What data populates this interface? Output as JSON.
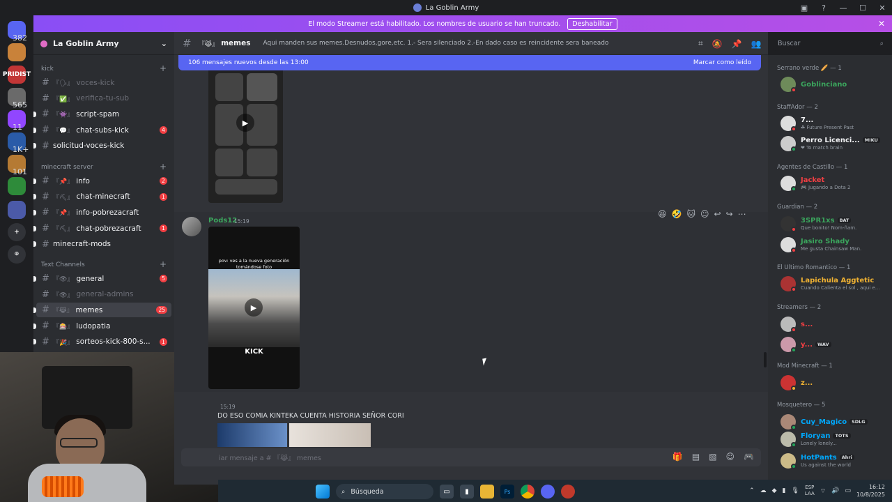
{
  "window": {
    "title": "La Goblin Army"
  },
  "banner": {
    "text": "El modo Streamer está habilitado. Los nombres de usuario se han truncado.",
    "button": "Deshabilitar"
  },
  "servers": [
    {
      "label": "",
      "count": "382",
      "color": "#5865f2"
    },
    {
      "label": "",
      "count": "",
      "color": "#c9823a"
    },
    {
      "label": "PRIDIST",
      "count": "",
      "color": "#c23636"
    },
    {
      "label": "",
      "count": "565",
      "color": "#6a6a6a"
    },
    {
      "label": "",
      "count": "11",
      "color": "#9146ff"
    },
    {
      "label": "",
      "count": "1K+",
      "color": "#2a5ba8"
    },
    {
      "label": "",
      "count": "101",
      "color": "#b57a33"
    },
    {
      "label": "",
      "count": "",
      "color": "#2e8b3a"
    },
    {
      "label": "",
      "count": "",
      "color": "#4b5aa8"
    }
  ],
  "guild": {
    "name": "La Goblin Army"
  },
  "categories": {
    "kick": "kick",
    "minecraft": "minecraft server",
    "text": "Text Channels"
  },
  "channels": {
    "kick": [
      {
        "emoji": "『🗣』",
        "name": "voces-kick",
        "badge": "",
        "state": "muted"
      },
      {
        "emoji": "『✅』",
        "name": "verifica-tu-sub",
        "badge": "",
        "state": "muted"
      },
      {
        "emoji": "『👾』",
        "name": "script-spam",
        "badge": "",
        "state": "unread"
      },
      {
        "emoji": "『💬』",
        "name": "chat-subs-kick",
        "badge": "4",
        "state": "unread"
      },
      {
        "emoji": "",
        "name": "solicitud-voces-kick",
        "badge": "",
        "state": "unread"
      }
    ],
    "minecraft": [
      {
        "emoji": "『📌』",
        "name": "info",
        "badge": "2",
        "state": "unread"
      },
      {
        "emoji": "『⛏』",
        "name": "chat-minecraft",
        "badge": "1",
        "state": "unread"
      },
      {
        "emoji": "『📌』",
        "name": "info-pobrezacraft",
        "badge": "",
        "state": "unread"
      },
      {
        "emoji": "『⛏』",
        "name": "chat-pobrezacraft",
        "badge": "1",
        "state": "unread"
      },
      {
        "emoji": "",
        "name": "minecraft-mods",
        "badge": "",
        "state": "unread"
      }
    ],
    "text": [
      {
        "emoji": "『👁』",
        "name": "general",
        "badge": "5",
        "state": "unread"
      },
      {
        "emoji": "『👁』",
        "name": "general-admins",
        "badge": "",
        "state": "muted"
      },
      {
        "emoji": "『😹』",
        "name": "memes",
        "badge": "25",
        "state": "active"
      },
      {
        "emoji": "『🎰』",
        "name": "ludopatia",
        "badge": "",
        "state": "unread"
      },
      {
        "emoji": "『🎉』",
        "name": "sorteos-kick-800-s...",
        "badge": "1",
        "state": "unread"
      }
    ]
  },
  "header": {
    "channel_emoji": "『😹』",
    "channel": "memes",
    "topic": "Aqui manden sus memes.Desnudos,gore,etc. 1.- Sera silenciado 2.-En dado caso es reincidente sera baneado"
  },
  "search": {
    "placeholder": "Buscar"
  },
  "newbar": {
    "text": "106 mensajes nuevos desde las 13:00",
    "action": "Marcar como leído"
  },
  "messages": [
    {
      "author": "Pods12",
      "time": "15:19",
      "video_caption": "pov: ves a la nueva generación tomándose foto",
      "video_brand": "KICK"
    },
    {
      "time": "15:19",
      "text": "DO ESO COMIA KINTEKA CUENTA HISTORIA SEÑOR CORI"
    }
  ],
  "composer": {
    "placeholder": "iar mensaje a # 『😹』 memes"
  },
  "members": {
    "groups": [
      {
        "title": "Serrano verde 🥖 — 1"
      },
      {
        "title": "StaffAdor — 2"
      },
      {
        "title": "Agentes de Castillo — 1"
      },
      {
        "title": "Guardian — 2"
      },
      {
        "title": "El Ultimo Romantico — 1"
      },
      {
        "title": "Streamers — 2"
      },
      {
        "title": "Mod Minecraft — 1"
      },
      {
        "title": "Mosquetero — 5"
      }
    ],
    "list": [
      {
        "name": "Goblinciano",
        "sub": "",
        "tag": "",
        "color": "#3ba55d"
      },
      {
        "name": "7...",
        "sub": "☘ Future Present Past",
        "tag": "",
        "color": "#f2f3f5"
      },
      {
        "name": "Perro Licenci...",
        "sub": "❤ To match brain",
        "tag": "MIKU",
        "color": "#f2f3f5"
      },
      {
        "name": "Jacket",
        "sub": "🎮 Jugando a Dota 2",
        "tag": "",
        "color": "#f23f43"
      },
      {
        "name": "3SPR1xs",
        "sub": "Que bonito! Nom-ñam.",
        "tag": "BAT",
        "color": "#3ba55d"
      },
      {
        "name": "Jasiro Shady",
        "sub": "Me gusta Chainsaw Man.",
        "tag": "",
        "color": "#3ba55d"
      },
      {
        "name": "Lapichula Aggtetic",
        "sub": "Cuando Calienta el sol , aqui e...",
        "tag": "",
        "color": "#f0b232"
      },
      {
        "name": "s...",
        "sub": "",
        "tag": "",
        "color": "#f23f43"
      },
      {
        "name": "y...",
        "sub": "",
        "tag": "WAV",
        "color": "#f23f43"
      },
      {
        "name": "z...",
        "sub": "",
        "tag": "",
        "color": "#f0b232"
      },
      {
        "name": "Cuy_Magico",
        "sub": "",
        "tag": "SDLG",
        "color": "#00a8fc"
      },
      {
        "name": "Floryan",
        "sub": "Lonely lonely...",
        "tag": "TOTS",
        "color": "#00a8fc"
      },
      {
        "name": "HotPants",
        "sub": "Us against the world",
        "tag": "Ahri",
        "color": "#00a8fc"
      }
    ]
  },
  "taskbar": {
    "search": "Búsqueda",
    "lang1": "ESP",
    "lang2": "LAA",
    "time": "16:12",
    "date": "10/8/2025"
  },
  "colors": {
    "accent": "#5865f2",
    "banner": "#b64fe6",
    "unread_badge": "#f23f43",
    "online": "#23a55a",
    "dnd": "#f23f43"
  }
}
